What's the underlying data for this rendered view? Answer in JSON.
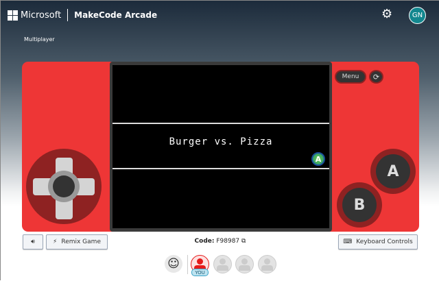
{
  "header": {
    "brand": "Microsoft",
    "product": "MakeCode Arcade",
    "avatar_initials": "GN",
    "settings_icon": "gear-icon"
  },
  "page": {
    "subtitle": "Multiplayer"
  },
  "game": {
    "title": "Burger vs. Pizza",
    "prompt_badge": "A",
    "menu_label": "Menu",
    "a_label": "A",
    "b_label": "B"
  },
  "toolbar": {
    "remix_label": "Remix Game",
    "keyboard_label": "Keyboard Controls",
    "code_label": "Code:",
    "code_value": "F98987"
  },
  "players": {
    "you_label": "YOU",
    "slots": 4
  },
  "colors": {
    "console": "#ee3636",
    "accent_ring": "#8e2222",
    "player1": "#e61a1a",
    "avatar": "#13878f"
  }
}
